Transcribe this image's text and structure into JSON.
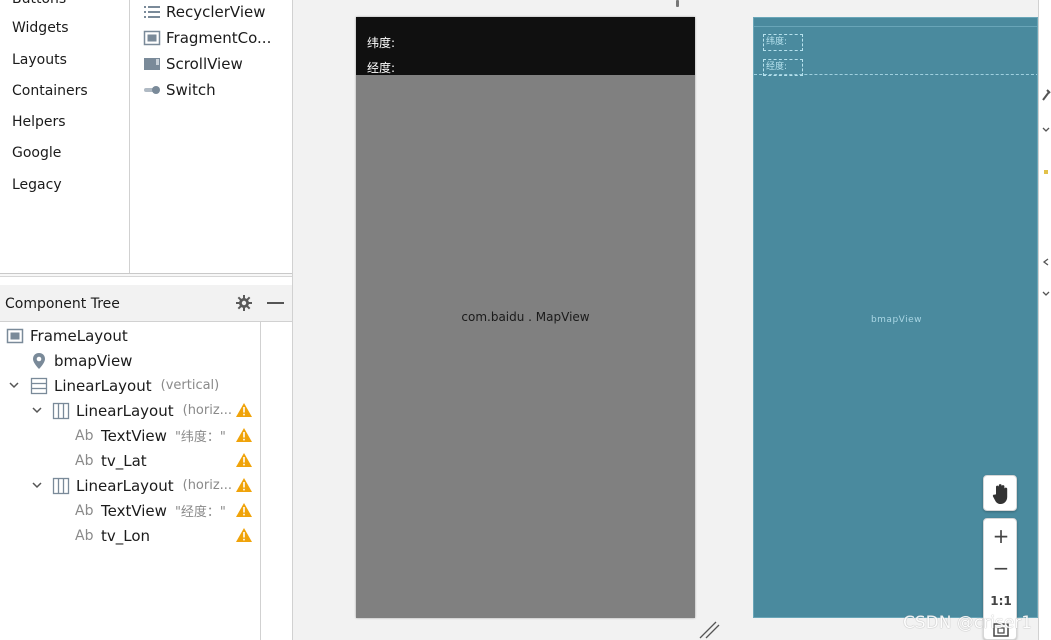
{
  "palette": {
    "categories": [
      "Buttons",
      "Widgets",
      "Layouts",
      "Containers",
      "Helpers",
      "Google",
      "Legacy"
    ],
    "items": [
      {
        "label": "RecyclerView",
        "icon": "list-icon"
      },
      {
        "label": "FragmentCo...",
        "icon": "fragment-icon"
      },
      {
        "label": "ScrollView",
        "icon": "scrollview-icon"
      },
      {
        "label": "Switch",
        "icon": "switch-icon"
      }
    ]
  },
  "component_tree": {
    "title": "Component Tree",
    "rows": [
      {
        "label": "FrameLayout",
        "hint": ""
      },
      {
        "label": "bmapView",
        "hint": ""
      },
      {
        "label": "LinearLayout",
        "hint": "(vertical)"
      },
      {
        "label": "LinearLayout",
        "hint": "(horiz..."
      },
      {
        "label": "TextView",
        "hint": "\"纬度：\""
      },
      {
        "label": "tv_Lat",
        "hint": ""
      },
      {
        "label": "LinearLayout",
        "hint": "(horiz..."
      },
      {
        "label": "TextView",
        "hint": "\"经度：\""
      },
      {
        "label": "tv_Lon",
        "hint": ""
      }
    ]
  },
  "design": {
    "lat_label": "纬度:",
    "lon_label": "经度:",
    "map_label": "com.baidu . MapView"
  },
  "blueprint": {
    "lat_label": "纬度:",
    "lon_label": "经度:",
    "map_label": "bmapView"
  },
  "zoom": {
    "zoom_in": "+",
    "zoom_out": "−",
    "actual_size": "1:1"
  },
  "watermark": "CSDN @criser1",
  "colors": {
    "design_top": "#101010",
    "design_map": "#808080",
    "blueprint": "#4a8a9e",
    "warning": "#f0a30a"
  }
}
